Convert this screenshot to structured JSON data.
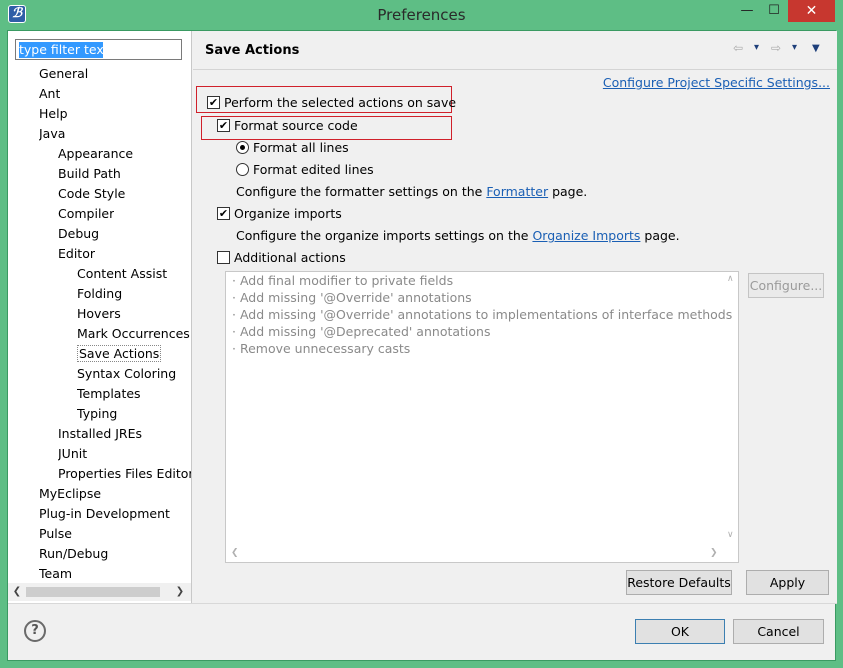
{
  "window": {
    "title": "Preferences",
    "controls": {
      "minimize": "—",
      "maximize": "☐",
      "close": "✕"
    },
    "app_icon": "ℬ"
  },
  "filter": {
    "value": "type filter text"
  },
  "tree": [
    {
      "label": "General",
      "level": 0
    },
    {
      "label": "Ant",
      "level": 0
    },
    {
      "label": "Help",
      "level": 0
    },
    {
      "label": "Java",
      "level": 0
    },
    {
      "label": "Appearance",
      "level": 1
    },
    {
      "label": "Build Path",
      "level": 1
    },
    {
      "label": "Code Style",
      "level": 1
    },
    {
      "label": "Compiler",
      "level": 1
    },
    {
      "label": "Debug",
      "level": 1
    },
    {
      "label": "Editor",
      "level": 1
    },
    {
      "label": "Content Assist",
      "level": 2
    },
    {
      "label": "Folding",
      "level": 2
    },
    {
      "label": "Hovers",
      "level": 2
    },
    {
      "label": "Mark Occurrences",
      "level": 2
    },
    {
      "label": "Save Actions",
      "level": 2,
      "selected": true
    },
    {
      "label": "Syntax Coloring",
      "level": 2
    },
    {
      "label": "Templates",
      "level": 2
    },
    {
      "label": "Typing",
      "level": 2
    },
    {
      "label": "Installed JREs",
      "level": 1
    },
    {
      "label": "JUnit",
      "level": 1
    },
    {
      "label": "Properties Files Editor",
      "level": 1
    },
    {
      "label": "MyEclipse",
      "level": 0
    },
    {
      "label": "Plug-in Development",
      "level": 0
    },
    {
      "label": "Pulse",
      "level": 0
    },
    {
      "label": "Run/Debug",
      "level": 0
    },
    {
      "label": "Team",
      "level": 0
    }
  ],
  "tree_scroll": {
    "left": "❮",
    "right": "❯"
  },
  "page": {
    "title": "Save Actions",
    "nav": {
      "back": "⇦",
      "back_menu": "▾",
      "forward": "⇨",
      "forward_menu": "▾",
      "view_menu": "▼"
    },
    "configure_project_link": "Configure Project Specific Settings...",
    "perform_actions": {
      "label": "Perform the selected actions on save",
      "checked": true
    },
    "format_source": {
      "label": "Format source code",
      "checked": true
    },
    "format_all": {
      "label": "Format all lines",
      "checked": true
    },
    "format_edited": {
      "label": "Format edited lines",
      "checked": false
    },
    "formatter_note": {
      "before": "Configure the formatter settings on the ",
      "link": "Formatter",
      "after": " page."
    },
    "organize_imports": {
      "label": "Organize imports",
      "checked": true
    },
    "organize_note": {
      "before": "Configure the organize imports settings on the ",
      "link": "Organize Imports",
      "after": " page."
    },
    "additional_actions": {
      "label": "Additional actions",
      "checked": false
    },
    "actions_list": [
      "· Add final modifier to private fields",
      "· Add missing '@Override' annotations",
      "· Add missing '@Override' annotations to implementations of interface methods",
      "· Add missing '@Deprecated' annotations",
      "· Remove unnecessary casts"
    ],
    "list_scroll": {
      "up": "∧",
      "down": "∨",
      "left": "❮",
      "right": "❯"
    },
    "configure_button": "Configure...",
    "restore_defaults": "Restore Defaults",
    "apply": "Apply"
  },
  "footer": {
    "help": "?",
    "ok": "OK",
    "cancel": "Cancel"
  },
  "colors": {
    "frame": "#5ebe85",
    "close": "#c7372f",
    "link": "#1a5fb4",
    "highlight_box": "#d0202a",
    "selection": "#3399ff"
  }
}
